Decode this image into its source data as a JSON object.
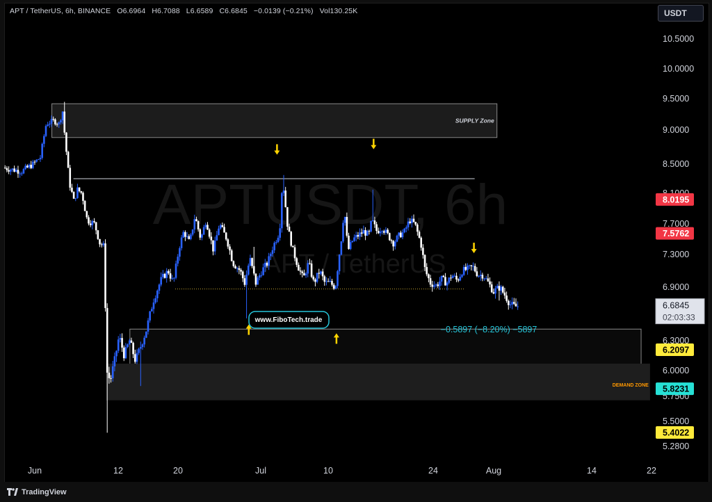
{
  "header": {
    "symbol": "APT / TetherUS, 6h, BINANCE",
    "open": "O6.6964",
    "high": "H6.7088",
    "low": "L6.6589",
    "close": "C6.6845",
    "change": "−0.0139 (−0.21%)",
    "volume": "Vol130.25K"
  },
  "currency_button": "USDT",
  "watermark": {
    "line1": "APTUSDT, 6h",
    "line2": "APT / TetherUS"
  },
  "footer": {
    "brand": "TradingView"
  },
  "annotations": {
    "supply": "SUPPLY Zone",
    "demand": "DEMAND ZONE",
    "website": "www.FiboTech.trade",
    "measure": "−0.5897 (−8.20%) −5897"
  },
  "colors": {
    "background": "#000000",
    "candle_up": "#2962ff",
    "candle_down": "#ffffff",
    "annotation_yellow": "#ffd400",
    "accent_cyan": "#26c6da",
    "price_red": "#f23645"
  },
  "price_badges": [
    {
      "label": "8.0195",
      "value": 8.0195,
      "bg": "#f23645",
      "fg": "#ffffff"
    },
    {
      "label": "7.5762",
      "value": 7.5762,
      "bg": "#f23645",
      "fg": "#ffffff"
    },
    {
      "label": "6.2097",
      "value": 6.2097,
      "bg": "#ffeb3b",
      "fg": "#000000"
    },
    {
      "label": "5.8231",
      "value": 5.8231,
      "bg": "#26e0d5",
      "fg": "#000000"
    },
    {
      "label": "5.4022",
      "value": 5.4022,
      "bg": "#ffeb3b",
      "fg": "#000000"
    }
  ],
  "last_price": {
    "label": "6.6845",
    "countdown": "02:03:33"
  },
  "chart_data": {
    "type": "candlestick",
    "title": "APTUSDT, 6h",
    "y_axis": {
      "ticks": [
        "10.5000",
        "10.0000",
        "9.5000",
        "9.0000",
        "8.5000",
        "8.1000",
        "7.7000",
        "7.3000",
        "6.9000",
        "6.3000",
        "6.0000",
        "5.7500",
        "5.5000",
        "5.2800"
      ],
      "tick_values": [
        10.5,
        10.0,
        9.5,
        9.0,
        8.5,
        8.1,
        7.7,
        7.3,
        6.9,
        6.3,
        6.0,
        5.75,
        5.5,
        5.28
      ],
      "range": [
        5.0,
        10.9
      ]
    },
    "x_axis": {
      "ticks": [
        "Jun",
        "12",
        "20",
        "Jul",
        "10",
        "24",
        "Aug",
        "14",
        "22"
      ],
      "tick_days": [
        0,
        11,
        19,
        30,
        40,
        54,
        62,
        75,
        83
      ],
      "range_days": [
        -4,
        86
      ]
    },
    "zones": [
      {
        "name": "SUPPLY Zone",
        "from_day": 2.3,
        "to_day": 62.2,
        "low": 8.89,
        "high": 9.42
      },
      {
        "name": "resistance box",
        "from_day": 12.8,
        "to_day": 81.6,
        "low": 6.06,
        "high": 6.43
      },
      {
        "name": "DEMAND ZONE",
        "from_day": 9.6,
        "to_day": 82.8,
        "low": 5.71,
        "high": 6.07
      }
    ],
    "lines": [
      {
        "name": "range top",
        "from_day": 5.2,
        "to_day": 59.2,
        "value": 8.3
      },
      {
        "name": "range bottom",
        "from_day": 18.9,
        "to_day": 57.8,
        "value": 6.88
      }
    ],
    "arrows": [
      {
        "direction": "down",
        "day": 32.6,
        "value": 8.72
      },
      {
        "direction": "down",
        "day": 45.6,
        "value": 8.8
      },
      {
        "direction": "up",
        "day": 28.8,
        "value": 6.42
      },
      {
        "direction": "up",
        "day": 40.6,
        "value": 6.32
      },
      {
        "direction": "down",
        "day": 59.1,
        "value": 7.39
      }
    ],
    "anchors": [
      [
        -4.0,
        8.45
      ],
      [
        -1.5,
        8.4
      ],
      [
        0.0,
        8.5
      ],
      [
        1.0,
        8.6
      ],
      [
        1.8,
        9.1
      ],
      [
        2.8,
        9.15
      ],
      [
        3.5,
        9.1
      ],
      [
        4.0,
        9.3
      ],
      [
        4.3,
        8.9
      ],
      [
        4.9,
        8.25
      ],
      [
        5.5,
        8.0
      ],
      [
        6.0,
        8.15
      ],
      [
        6.6,
        8.1
      ],
      [
        7.3,
        7.75
      ],
      [
        8.3,
        7.7
      ],
      [
        9.0,
        7.45
      ],
      [
        9.6,
        7.4
      ],
      [
        9.9,
        6.0
      ],
      [
        10.4,
        5.9
      ],
      [
        11.0,
        6.1
      ],
      [
        11.6,
        6.35
      ],
      [
        12.3,
        6.15
      ],
      [
        13.0,
        6.3
      ],
      [
        13.8,
        6.1
      ],
      [
        14.3,
        6.2
      ],
      [
        15.2,
        6.4
      ],
      [
        16.2,
        6.75
      ],
      [
        17.3,
        7.0
      ],
      [
        18.2,
        7.1
      ],
      [
        18.9,
        6.95
      ],
      [
        19.7,
        7.4
      ],
      [
        20.3,
        7.6
      ],
      [
        21.1,
        7.45
      ],
      [
        21.8,
        7.8
      ],
      [
        22.6,
        7.5
      ],
      [
        23.3,
        7.75
      ],
      [
        24.3,
        7.35
      ],
      [
        25.1,
        7.7
      ],
      [
        26.1,
        7.5
      ],
      [
        26.9,
        7.2
      ],
      [
        27.9,
        7.1
      ],
      [
        28.5,
        6.95
      ],
      [
        29.2,
        7.25
      ],
      [
        30.0,
        6.95
      ],
      [
        30.8,
        7.1
      ],
      [
        31.6,
        7.2
      ],
      [
        32.3,
        7.4
      ],
      [
        33.2,
        7.6
      ],
      [
        33.6,
        8.3
      ],
      [
        34.3,
        7.65
      ],
      [
        35.0,
        7.35
      ],
      [
        35.7,
        7.15
      ],
      [
        36.4,
        7.0
      ],
      [
        37.1,
        7.2
      ],
      [
        37.8,
        6.95
      ],
      [
        38.6,
        7.1
      ],
      [
        39.3,
        6.95
      ],
      [
        40.0,
        6.95
      ],
      [
        40.7,
        6.9
      ],
      [
        41.5,
        7.5
      ],
      [
        41.9,
        7.9
      ],
      [
        42.4,
        7.35
      ],
      [
        43.1,
        7.5
      ],
      [
        43.8,
        7.55
      ],
      [
        44.5,
        7.6
      ],
      [
        45.2,
        7.55
      ],
      [
        45.6,
        7.75
      ],
      [
        46.3,
        7.6
      ],
      [
        47.0,
        7.65
      ],
      [
        47.8,
        7.55
      ],
      [
        48.5,
        7.45
      ],
      [
        49.3,
        7.55
      ],
      [
        50.0,
        7.6
      ],
      [
        50.7,
        7.75
      ],
      [
        51.4,
        7.7
      ],
      [
        52.2,
        7.45
      ],
      [
        52.8,
        7.1
      ],
      [
        53.5,
        6.95
      ],
      [
        54.3,
        6.92
      ],
      [
        55.0,
        7.0
      ],
      [
        55.7,
        6.95
      ],
      [
        56.4,
        7.05
      ],
      [
        57.1,
        6.98
      ],
      [
        57.8,
        7.1
      ],
      [
        58.5,
        7.12
      ],
      [
        59.2,
        7.15
      ],
      [
        59.9,
        7.05
      ],
      [
        60.6,
        7.05
      ],
      [
        61.3,
        6.95
      ],
      [
        62.0,
        6.85
      ],
      [
        62.8,
        6.9
      ],
      [
        63.6,
        6.8
      ],
      [
        64.3,
        6.7
      ],
      [
        65.0,
        6.68
      ]
    ],
    "candle_step_days": 0.25,
    "last_close": 6.6845,
    "volume_label": "Vol130.25K"
  }
}
